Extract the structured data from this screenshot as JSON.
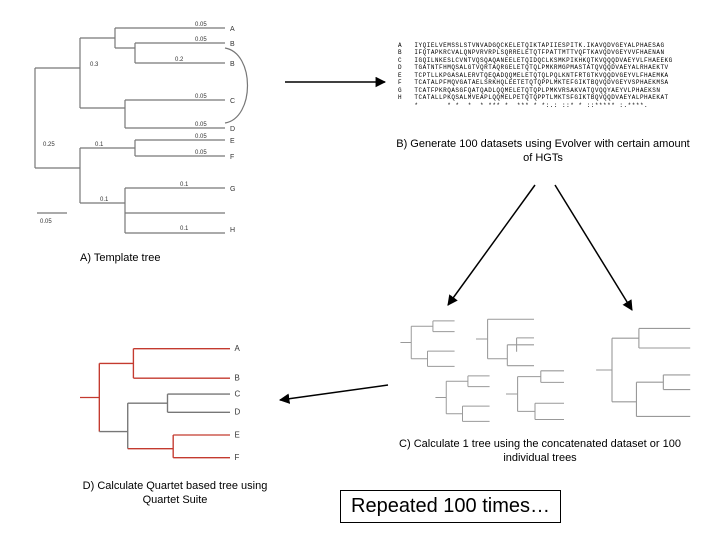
{
  "labels": {
    "A": "A) Template tree",
    "B": "B) Generate 100 datasets using Evolver with certain amount of HGTs",
    "C": "C) Calculate 1 tree using the concatenated dataset or 100 individual trees",
    "D": "D) Calculate Quartet based tree using Quartet Suite",
    "big": "Repeated 100 times…"
  },
  "template_tree": {
    "scale_label": "0.05",
    "tips": [
      "A",
      "B",
      "B",
      "C",
      "D",
      "E",
      "F",
      "G",
      "H"
    ],
    "branch_lengths": [
      "0.05",
      "0.3",
      "0.05",
      "0.2",
      "0.05",
      "0.05",
      "0.25",
      "0.1",
      "0.05",
      "0.05",
      "0.1",
      "0.1",
      "0.1"
    ]
  },
  "alignment": {
    "names": [
      "A",
      "B",
      "C",
      "D",
      "E",
      "F",
      "G",
      "H"
    ],
    "rows": [
      "IYQIELVEMSSLSTVNVADGQCKELETQIKTAPIIESPITK.IKAVQDVGEYALPHAESAG",
      "IFQTAPKRCVALQNPVRVRPLSQRRELETQTFPATTMTTVQFTKAVQDVGEYVVFHAENAN",
      "IGQILNKESLCVNTVQSQAQANEELETQIDQCLKSMKPIKHKQTKVQQQDVAEYVLFHAEEKG",
      "TGATNTFHMQSALGTVQRTAQRGELETQTQLPMKRMGPMASTATQVQQDVAEYALRHAEKTV",
      "TCPTLLKPGASALERVTQEQADQQMELETQTQLPQLKNTFRTGTKVQQDVGEYVLFHAEMKA",
      "TCATALPFMQVGATAELSRKHQLEETETQTQPPLMKTEFGIKTBQVQDVGEYVSPHAEKMSA",
      "TCATFPKRQASGFQATQADLQQMELETQTQPLPMKVRSAKVATQVQQYAEYVLPHAEKSN",
      "TCATALLPKQSALMVEAPLQQMELPETQTQPPTLMKTSFGIKTBQVQQDVAEYALPHAEKAT"
    ],
    "consensus": "*       * *  *  * *** *  *** * *:.: ::* * ::***** :.****.  "
  }
}
